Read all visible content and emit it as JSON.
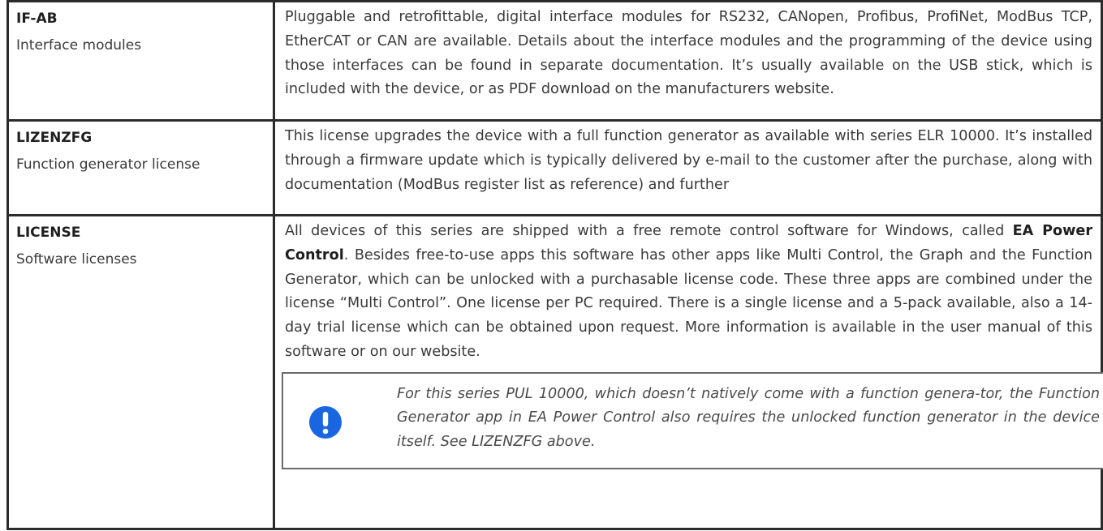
{
  "rows": [
    {
      "code": "IF-AB",
      "subtitle": "Interface modules",
      "description": "Pluggable and retrofittable, digital interface modules for RS232, CANopen, Profibus, ProfiNet, ModBus TCP, EtherCAT or CAN are available. Details about the interface modules and the programming of the device using those interfaces can be found in separate documentation. It’s usually available on the USB stick, which is included with the device, or as PDF download on the manufacturers website."
    },
    {
      "code": "LIZENZFG",
      "subtitle": "Function generator license",
      "description": "This license upgrades the device with a full function generator as available with series ELR 10000. It’s installed through a firmware update which is typically delivered by e-mail to the customer after the purchase, along with documentation (ModBus register list as reference) and further"
    },
    {
      "code": "LICENSE",
      "subtitle": "Software licenses",
      "description_prefix": "All devices of this series are shipped with a free remote control software for Windows, called ",
      "description_bold": "EA Power Control",
      "description_suffix": ". Besides free-to-use apps this software has other apps like Multi Control, the Graph and the Function Generator, which can be unlocked with a purchasable license code. These three apps are combined under the license “Multi Control”. One license per PC required. There is a single license and a 5-pack available, also a 14-day trial license which can be obtained upon request. More information is available in the user manual of this software or on our website.",
      "note": {
        "icon": "exclamation-icon",
        "icon_color": "#1a66e0",
        "text": "For this series PUL 10000, which doesn’t natively come with a function genera-tor, the Function Generator app in EA Power Control also requires the unlocked function generator in the device itself. See LIZENZFG above."
      }
    }
  ]
}
